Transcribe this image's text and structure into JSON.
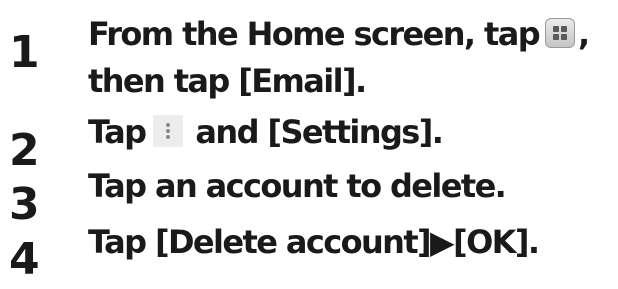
{
  "steps": [
    {
      "number": "1",
      "line1_before_icon": "From the Home screen, tap",
      "icon": "apps-grid-icon",
      "line1_after_icon": ",",
      "line2": "then tap [Email]."
    },
    {
      "number": "2",
      "before_icon": "Tap",
      "icon": "more-options-vertical-dots-icon",
      "after_icon": "and [Settings]."
    },
    {
      "number": "3",
      "text": "Tap an account to delete."
    },
    {
      "number": "4",
      "text": "Tap [Delete account]▶[OK]."
    }
  ]
}
